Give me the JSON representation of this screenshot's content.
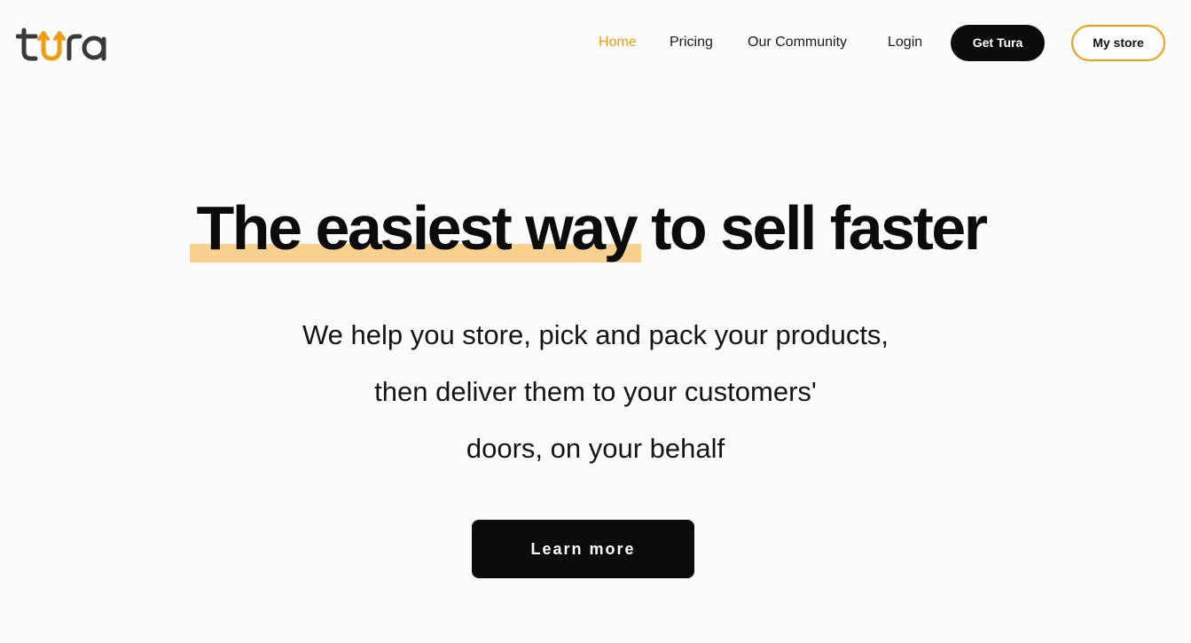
{
  "brand": {
    "logo_text": "tura",
    "accent_color": "#f39a12",
    "dark_color": "#0b0b0b",
    "highlight_color": "#f7b343"
  },
  "nav": {
    "links": [
      {
        "label": "Home",
        "active": true
      },
      {
        "label": "Pricing",
        "active": false
      },
      {
        "label": "Our Community",
        "active": false
      },
      {
        "label": "Login",
        "active": false
      }
    ],
    "get_button": "Get Tura",
    "store_button": "My store"
  },
  "hero": {
    "title_highlight": "The easiest way",
    "title_rest": " to sell faster",
    "subtitle_lines": [
      "We help you store, pick and pack your products,",
      "then deliver them to your customers'",
      "doors, on your behalf"
    ],
    "cta": "Learn more"
  }
}
